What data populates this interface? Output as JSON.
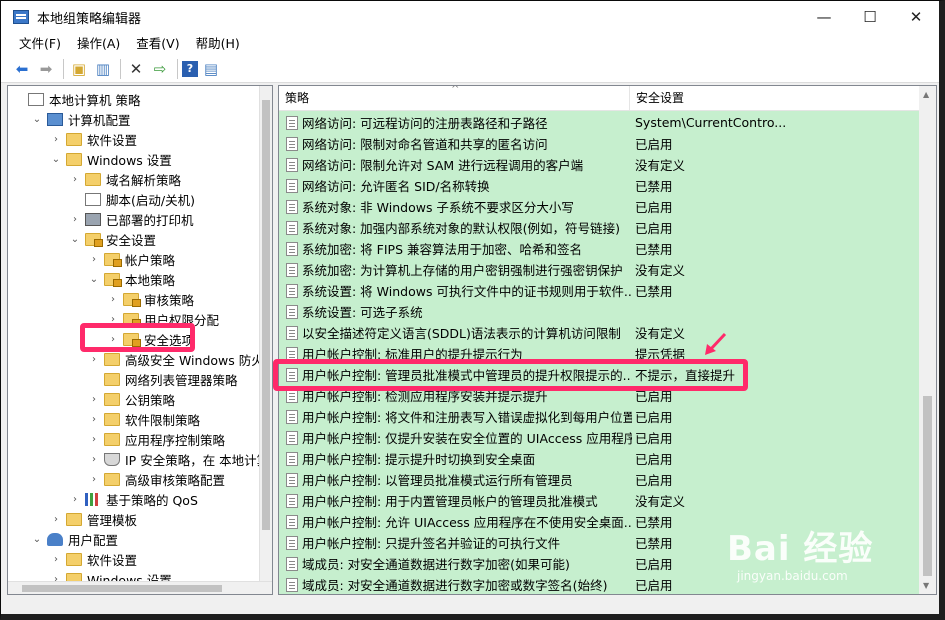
{
  "window": {
    "title": "本地组策略编辑器",
    "min": "—",
    "max": "☐",
    "close": "✕"
  },
  "menu": [
    "文件(F)",
    "操作(A)",
    "查看(V)",
    "帮助(H)"
  ],
  "toolbar": [
    "back-icon",
    "forward-icon",
    "up-folder-icon",
    "show-hide-tree-icon",
    "delete-icon",
    "export-icon",
    "help-icon",
    "properties-icon"
  ],
  "tree": [
    {
      "label": "本地计算机 策略",
      "icon": "doc",
      "indent": 0,
      "chev": ""
    },
    {
      "label": "计算机配置",
      "icon": "computer",
      "indent": 1,
      "chev": "⌄"
    },
    {
      "label": "软件设置",
      "icon": "folder",
      "indent": 2,
      "chev": "›"
    },
    {
      "label": "Windows 设置",
      "icon": "folder",
      "indent": 2,
      "chev": "⌄"
    },
    {
      "label": "域名解析策略",
      "icon": "folder",
      "indent": 3,
      "chev": "›"
    },
    {
      "label": "脚本(启动/关机)",
      "icon": "doc",
      "indent": 3,
      "chev": ""
    },
    {
      "label": "已部署的打印机",
      "icon": "printer",
      "indent": 3,
      "chev": "›"
    },
    {
      "label": "安全设置",
      "icon": "folder lock",
      "indent": 3,
      "chev": "⌄"
    },
    {
      "label": "帐户策略",
      "icon": "folder lock",
      "indent": 4,
      "chev": "›"
    },
    {
      "label": "本地策略",
      "icon": "folder lock",
      "indent": 4,
      "chev": "⌄"
    },
    {
      "label": "审核策略",
      "icon": "folder lock",
      "indent": 5,
      "chev": "›"
    },
    {
      "label": "用户权限分配",
      "icon": "folder lock",
      "indent": 5,
      "chev": "›"
    },
    {
      "label": "安全选项",
      "icon": "folder lock",
      "indent": 5,
      "chev": "›"
    },
    {
      "label": "高级安全 Windows 防火墙",
      "icon": "folder",
      "indent": 4,
      "chev": "›"
    },
    {
      "label": "网络列表管理器策略",
      "icon": "folder",
      "indent": 4,
      "chev": ""
    },
    {
      "label": "公钥策略",
      "icon": "folder",
      "indent": 4,
      "chev": "›"
    },
    {
      "label": "软件限制策略",
      "icon": "folder",
      "indent": 4,
      "chev": "›"
    },
    {
      "label": "应用程序控制策略",
      "icon": "folder",
      "indent": 4,
      "chev": "›"
    },
    {
      "label": "IP 安全策略，在 本地计算机",
      "icon": "shield",
      "indent": 4,
      "chev": "›"
    },
    {
      "label": "高级审核策略配置",
      "icon": "folder",
      "indent": 4,
      "chev": "›"
    },
    {
      "label": "基于策略的 QoS",
      "icon": "chart",
      "indent": 3,
      "chev": "›"
    },
    {
      "label": "管理模板",
      "icon": "folder",
      "indent": 2,
      "chev": "›"
    },
    {
      "label": "用户配置",
      "icon": "user",
      "indent": 1,
      "chev": "⌄"
    },
    {
      "label": "软件设置",
      "icon": "folder",
      "indent": 2,
      "chev": "›"
    },
    {
      "label": "Windows 设置",
      "icon": "folder",
      "indent": 2,
      "chev": "›"
    }
  ],
  "columns": {
    "policy": "策略",
    "setting": "安全设置"
  },
  "policies": [
    {
      "name": "网络访问: 可远程访问的注册表路径和子路径",
      "value": "System\\CurrentContro..."
    },
    {
      "name": "网络访问: 限制对命名管道和共享的匿名访问",
      "value": "已启用"
    },
    {
      "name": "网络访问: 限制允许对 SAM 进行远程调用的客户端",
      "value": "没有定义"
    },
    {
      "name": "网络访问: 允许匿名 SID/名称转换",
      "value": "已禁用"
    },
    {
      "name": "系统对象: 非 Windows 子系统不要求区分大小写",
      "value": "已启用"
    },
    {
      "name": "系统对象: 加强内部系统对象的默认权限(例如，符号链接)",
      "value": "已启用"
    },
    {
      "name": "系统加密: 将 FIPS 兼容算法用于加密、哈希和签名",
      "value": "已禁用"
    },
    {
      "name": "系统加密: 为计算机上存储的用户密钥强制进行强密钥保护",
      "value": "没有定义"
    },
    {
      "name": "系统设置: 将 Windows 可执行文件中的证书规则用于软件...",
      "value": "已禁用"
    },
    {
      "name": "系统设置: 可选子系统",
      "value": ""
    },
    {
      "name": "以安全描述符定义语言(SDDL)语法表示的计算机访问限制",
      "value": "没有定义"
    },
    {
      "name": "用户帐户控制: 标准用户的提升提示行为",
      "value": "提示凭据"
    },
    {
      "name": "用户帐户控制: 管理员批准模式中管理员的提升权限提示的...",
      "value": "不提示，直接提升"
    },
    {
      "name": "用户帐户控制: 检测应用程序安装并提示提升",
      "value": "已启用"
    },
    {
      "name": "用户帐户控制: 将文件和注册表写入错误虚拟化到每用户位置",
      "value": "已启用"
    },
    {
      "name": "用户帐户控制: 仅提升安装在安全位置的 UIAccess 应用程序",
      "value": "已启用"
    },
    {
      "name": "用户帐户控制: 提示提升时切换到安全桌面",
      "value": "已启用"
    },
    {
      "name": "用户帐户控制: 以管理员批准模式运行所有管理员",
      "value": "已启用"
    },
    {
      "name": "用户帐户控制: 用于内置管理员帐户的管理员批准模式",
      "value": "没有定义"
    },
    {
      "name": "用户帐户控制: 允许 UIAccess 应用程序在不使用安全桌面...",
      "value": "已禁用"
    },
    {
      "name": "用户帐户控制: 只提升签名并验证的可执行文件",
      "value": "已禁用"
    },
    {
      "name": "域成员: 对安全通道数据进行数字加密(如果可能)",
      "value": "已启用"
    },
    {
      "name": "域成员: 对安全通道数据进行数字加密或数字签名(始终)",
      "value": "已启用"
    }
  ],
  "watermark": {
    "brand": "Bai 经验",
    "url": "jingyan.baidu.com"
  },
  "colors": {
    "list_bg": "#c6efce",
    "highlight": "#ff2a6a"
  }
}
